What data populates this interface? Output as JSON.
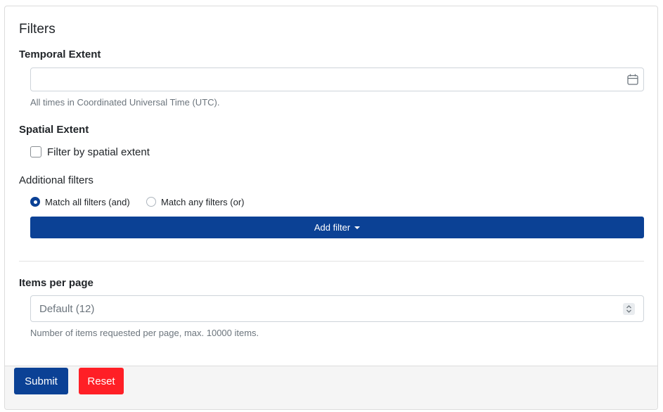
{
  "filters": {
    "title": "Filters",
    "temporal": {
      "label": "Temporal Extent",
      "value": "",
      "placeholder": "",
      "icon": "calendar-icon",
      "help": "All times in Coordinated Universal Time (UTC)."
    },
    "spatial": {
      "label": "Spatial Extent",
      "checkbox_label": "Filter by spatial extent",
      "checked": false
    },
    "additional": {
      "label": "Additional filters",
      "match_all_label": "Match all filters (and)",
      "match_any_label": "Match any filters (or)",
      "selected": "and",
      "add_filter_label": "Add filter"
    },
    "items_per_page": {
      "label": "Items per page",
      "selected": "Default (12)",
      "help": "Number of items requested per page, max. 10000 items."
    }
  },
  "footer": {
    "submit_label": "Submit",
    "reset_label": "Reset"
  },
  "colors": {
    "primary": "#0b4195",
    "danger": "#ff1f26",
    "footer_bg": "#f5f5f5"
  }
}
